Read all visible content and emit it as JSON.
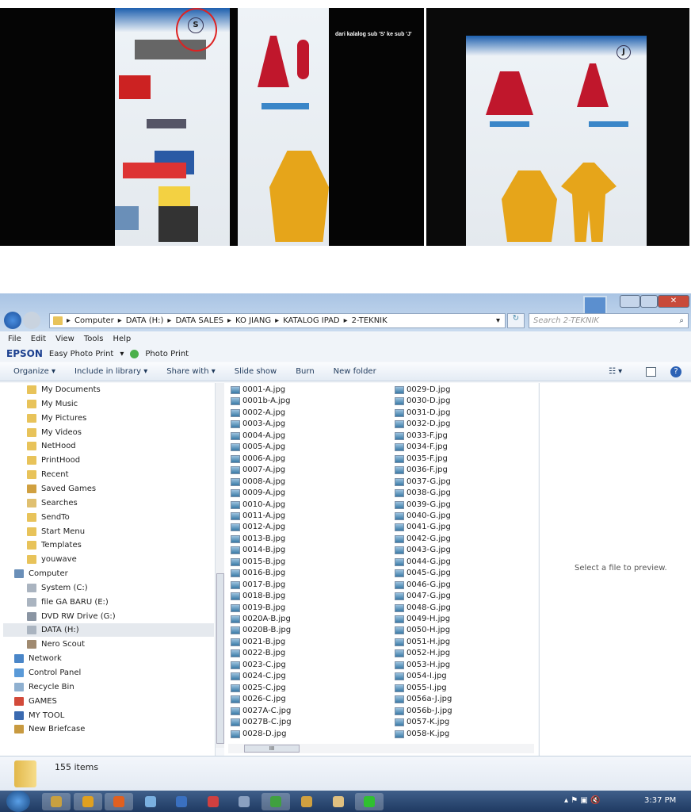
{
  "photos": {
    "caption": "dari kalalog sub 'S' ke sub 'J'",
    "logo_left": "S",
    "logo_right": "J"
  },
  "window": {
    "breadcrumb": [
      "Computer",
      "DATA (H:)",
      "DATA SALES",
      "KO JIANG",
      "KATALOG IPAD",
      "2-TEKNIK"
    ],
    "search_placeholder": "Search 2-TEKNIK",
    "menu": [
      "File",
      "Edit",
      "View",
      "Tools",
      "Help"
    ],
    "epson": {
      "brand": "EPSON",
      "easy": "Easy Photo Print",
      "photo": "Photo Print"
    },
    "toolbar": [
      "Organize",
      "Include in library",
      "Share with",
      "Slide show",
      "Burn",
      "New folder"
    ],
    "nav_items": [
      {
        "label": "My Documents",
        "icon": "folder-shortcut-icon",
        "indent": 1
      },
      {
        "label": "My Music",
        "icon": "folder-shortcut-icon",
        "indent": 1
      },
      {
        "label": "My Pictures",
        "icon": "folder-shortcut-icon",
        "indent": 1
      },
      {
        "label": "My Videos",
        "icon": "folder-shortcut-icon",
        "indent": 1
      },
      {
        "label": "NetHood",
        "icon": "folder-shortcut-icon",
        "indent": 1
      },
      {
        "label": "PrintHood",
        "icon": "folder-shortcut-icon",
        "indent": 1
      },
      {
        "label": "Recent",
        "icon": "folder-shortcut-icon",
        "indent": 1
      },
      {
        "label": "Saved Games",
        "icon": "saved-games-icon",
        "indent": 1
      },
      {
        "label": "Searches",
        "icon": "searches-icon",
        "indent": 1
      },
      {
        "label": "SendTo",
        "icon": "folder-shortcut-icon",
        "indent": 1
      },
      {
        "label": "Start Menu",
        "icon": "folder-shortcut-icon",
        "indent": 1
      },
      {
        "label": "Templates",
        "icon": "folder-shortcut-icon",
        "indent": 1
      },
      {
        "label": "youwave",
        "icon": "folder-icon",
        "indent": 1
      },
      {
        "label": "Computer",
        "icon": "computer-icon",
        "indent": 0
      },
      {
        "label": "System (C:)",
        "icon": "drive-icon",
        "indent": 1
      },
      {
        "label": "file GA BARU (E:)",
        "icon": "drive-icon",
        "indent": 1
      },
      {
        "label": "DVD RW Drive (G:)",
        "icon": "dvd-drive-icon",
        "indent": 1
      },
      {
        "label": "DATA (H:)",
        "icon": "drive-icon",
        "indent": 1,
        "selected": true
      },
      {
        "label": "Nero Scout",
        "icon": "nero-scout-icon",
        "indent": 1
      },
      {
        "label": "Network",
        "icon": "network-icon",
        "indent": 0
      },
      {
        "label": "Control Panel",
        "icon": "control-panel-icon",
        "indent": 0
      },
      {
        "label": "Recycle Bin",
        "icon": "recycle-bin-icon",
        "indent": 0
      },
      {
        "label": "GAMES",
        "icon": "games-icon",
        "indent": 0
      },
      {
        "label": "MY TOOL",
        "icon": "tool-icon",
        "indent": 0
      },
      {
        "label": "New Briefcase",
        "icon": "briefcase-icon",
        "indent": 0
      }
    ],
    "files_col1": [
      "0001-A.jpg",
      "0001b-A.jpg",
      "0002-A.jpg",
      "0003-A.jpg",
      "0004-A.jpg",
      "0005-A.jpg",
      "0006-A.jpg",
      "0007-A.jpg",
      "0008-A.jpg",
      "0009-A.jpg",
      "0010-A.jpg",
      "0011-A.jpg",
      "0012-A.jpg",
      "0013-B.jpg",
      "0014-B.jpg",
      "0015-B.jpg",
      "0016-B.jpg",
      "0017-B.jpg",
      "0018-B.jpg",
      "0019-B.jpg",
      "0020A-B.jpg",
      "0020B-B.jpg",
      "0021-B.jpg",
      "0022-B.jpg",
      "0023-C.jpg",
      "0024-C.jpg",
      "0025-C.jpg",
      "0026-C.jpg",
      "0027A-C.jpg",
      "0027B-C.jpg",
      "0028-D.jpg"
    ],
    "files_col2": [
      "0029-D.jpg",
      "0030-D.jpg",
      "0031-D.jpg",
      "0032-D.jpg",
      "0033-F.jpg",
      "0034-F.jpg",
      "0035-F.jpg",
      "0036-F.jpg",
      "0037-G.jpg",
      "0038-G.jpg",
      "0039-G.jpg",
      "0040-G.jpg",
      "0041-G.jpg",
      "0042-G.jpg",
      "0043-G.jpg",
      "0044-G.jpg",
      "0045-G.jpg",
      "0046-G.jpg",
      "0047-G.jpg",
      "0048-G.jpg",
      "0049-H.jpg",
      "0050-H.jpg",
      "0051-H.jpg",
      "0052-H.jpg",
      "0053-H.jpg",
      "0054-I.jpg",
      "0055-I.jpg",
      "0056a-J.jpg",
      "0056b-J.jpg",
      "0057-K.jpg",
      "0058-K.jpg"
    ],
    "preview_text": "Select a file to preview.",
    "status": "155 items"
  },
  "taskbar": {
    "clock": "3:37 PM",
    "apps": [
      "explorer",
      "media-player",
      "firefox",
      "app4",
      "app5",
      "app6",
      "itunes",
      "app8",
      "app9",
      "app10",
      "app11"
    ]
  }
}
